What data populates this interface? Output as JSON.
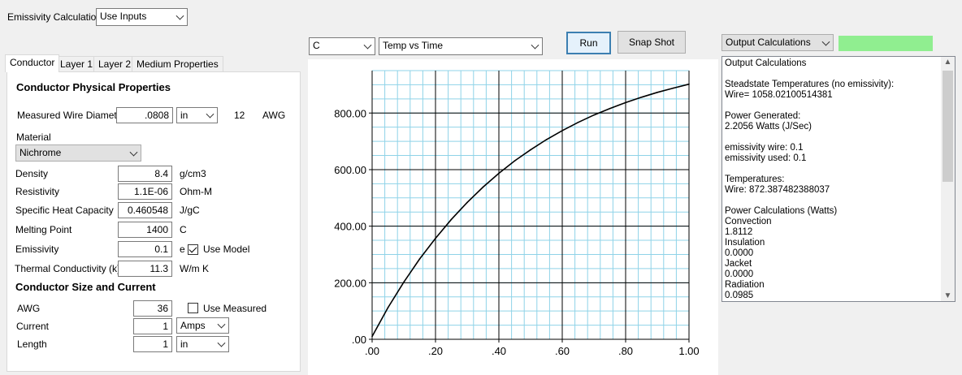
{
  "header": {
    "emissivity_label": "Emissivity Calculation",
    "emissivity_value": "Use Inputs"
  },
  "toolbar": {
    "unit_value": "C",
    "plot_value": "Temp vs Time",
    "run_label": "Run",
    "snapshot_label": "Snap Shot",
    "output_select": "Output Calculations",
    "status_color": "#90ee90"
  },
  "tabs": [
    {
      "label": "Conductor",
      "active": true
    },
    {
      "label": "Layer 1"
    },
    {
      "label": "Layer 2"
    },
    {
      "label": "Medium Properties"
    }
  ],
  "conductor": {
    "section_title": "Conductor Physical Properties",
    "measured_diameter_label": "Measured Wire Diameter",
    "measured_diameter_value": ".0808",
    "measured_diameter_unit": "in",
    "awg_computed": "12",
    "awg_label": "AWG",
    "material_label": "Material",
    "material_value": "Nichrome",
    "density_label": "Density",
    "density_value": "8.4",
    "density_unit": "g/cm3",
    "resistivity_label": "Resistivity",
    "resistivity_value": "1.1E-06",
    "resistivity_unit": "Ohm-M",
    "heat_capacity_label": "Specific Heat Capacity",
    "heat_capacity_value": "0.460548",
    "heat_capacity_unit": "J/gC",
    "melting_label": "Melting Point",
    "melting_value": "1400",
    "melting_unit": "C",
    "emissivity_label": "Emissivity",
    "emissivity_value": "0.1",
    "emissivity_unit": "e",
    "use_model_label": "Use Model",
    "use_model_checked": true,
    "thermal_label": "Thermal Conductivity (k)",
    "thermal_value": "11.3",
    "thermal_unit": "W/m K",
    "size_title": "Conductor Size and Current",
    "awg_field_label": "AWG",
    "awg_value": "36",
    "use_measured_label": "Use Measured",
    "use_measured_checked": false,
    "current_label": "Current",
    "current_value": "1",
    "current_unit": "Amps",
    "length_label": "Length",
    "length_value": "1",
    "length_unit": "in"
  },
  "output": {
    "lines": [
      "Output Calculations",
      "",
      "Steadstate Temperatures (no emissivity):",
      "Wire= 1058.02100514381",
      "",
      "Power Generated:",
      "2.2056 Watts (J/Sec)",
      "",
      "emissivity wire: 0.1",
      "emissivity used: 0.1",
      "",
      "Temperatures:",
      "Wire: 872.387482388037",
      "",
      "Power Calculations (Watts)",
      "Convection",
      "1.8112",
      "Insulation",
      "0.0000",
      "Jacket",
      "0.0000",
      "Radiation",
      "0.0985"
    ]
  },
  "chart_data": {
    "type": "line",
    "xlim": [
      0,
      1
    ],
    "ylim": [
      0,
      800
    ],
    "x_ticks": [
      ".00",
      ".20",
      ".40",
      ".60",
      ".80",
      "1.00"
    ],
    "x_tick_values": [
      0,
      0.2,
      0.4,
      0.6,
      0.8,
      1.0
    ],
    "y_ticks": [
      ".00",
      "200.00",
      "400.00",
      "600.00",
      "800.00"
    ],
    "y_tick_values": [
      0,
      200,
      400,
      600,
      800
    ],
    "grid": true,
    "series": [
      {
        "color": "#000000",
        "x": [
          0,
          0.05,
          0.1,
          0.15,
          0.2,
          0.25,
          0.3,
          0.35,
          0.4,
          0.45,
          0.5,
          0.55,
          0.6,
          0.65,
          0.7,
          0.75,
          0.8,
          0.85,
          0.9,
          0.95,
          1.0
        ],
        "y": [
          10,
          112,
          202,
          284,
          357,
          424,
          484,
          538,
          587,
          631,
          670,
          706,
          738,
          767,
          793,
          816,
          837,
          856,
          873,
          888,
          902
        ]
      }
    ]
  }
}
